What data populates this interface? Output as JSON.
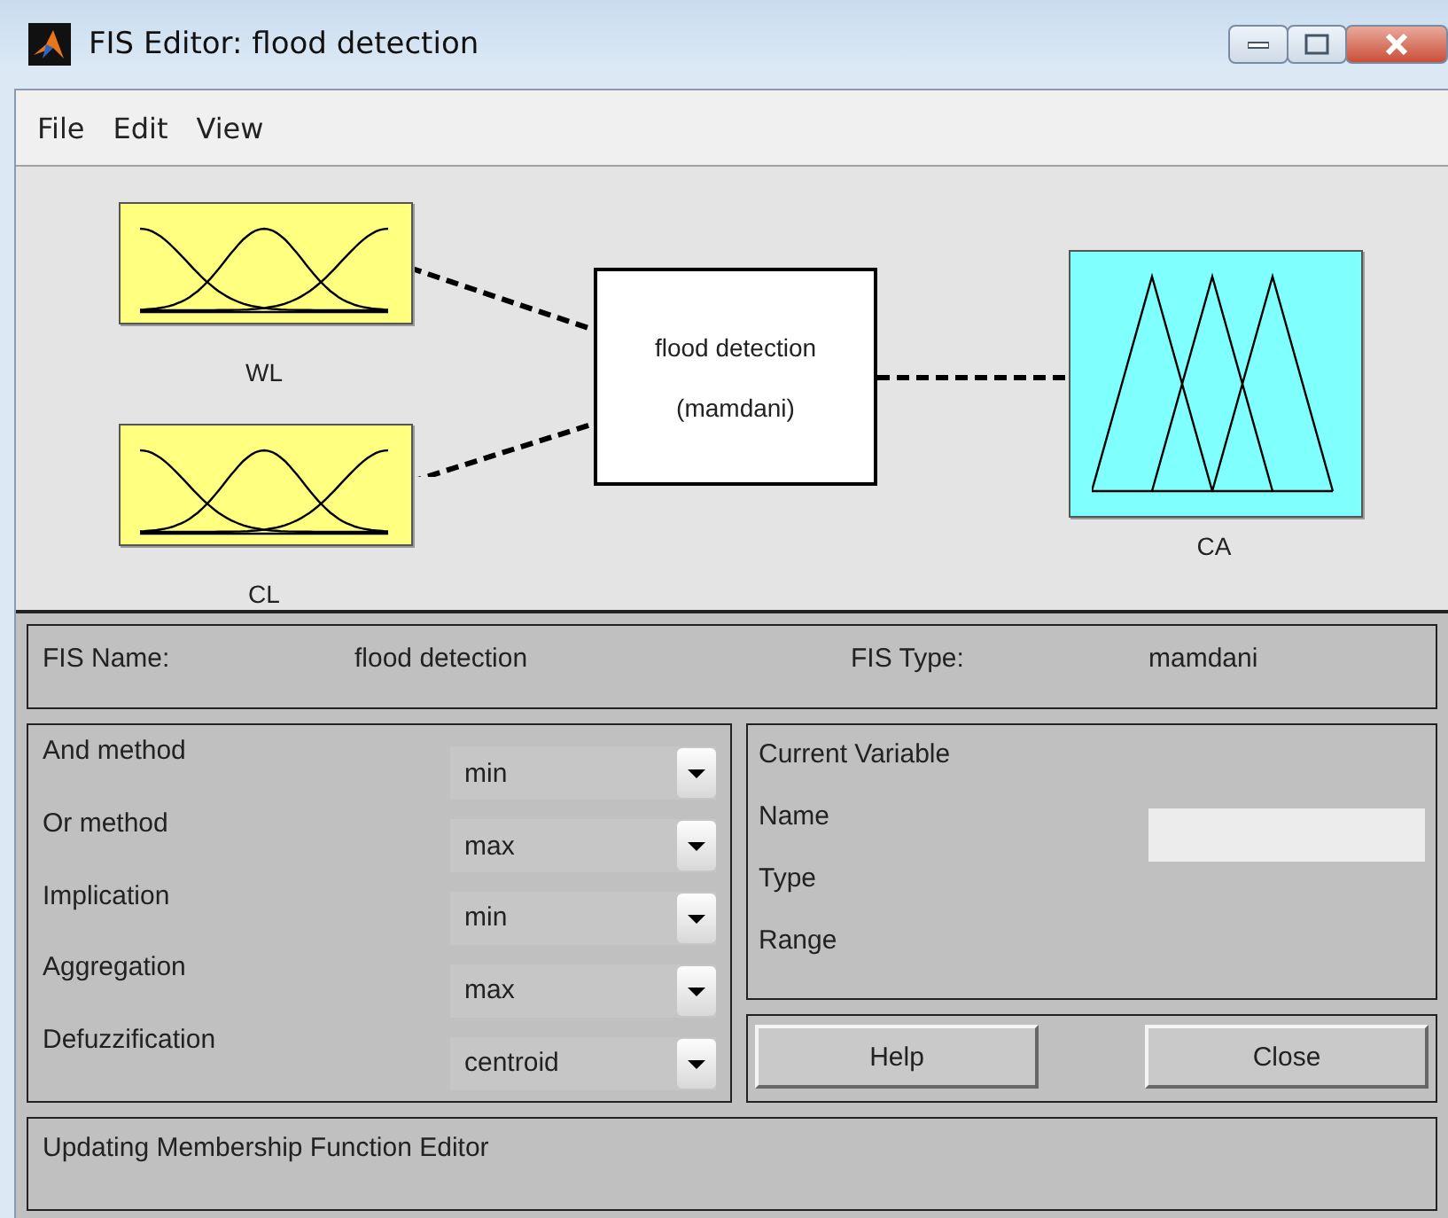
{
  "window": {
    "title": "FIS Editor: flood detection"
  },
  "menu": [
    "File",
    "Edit",
    "View"
  ],
  "diagram": {
    "inputs": [
      {
        "name": "WL"
      },
      {
        "name": "CL"
      }
    ],
    "system": {
      "name": "flood detection",
      "type": "(mamdani)"
    },
    "outputs": [
      {
        "name": "CA"
      }
    ]
  },
  "fis": {
    "name_label": "FIS Name:",
    "name": "flood detection",
    "type_label": "FIS Type:",
    "type": "mamdani"
  },
  "methods": [
    {
      "label": "And method",
      "value": "min"
    },
    {
      "label": "Or method",
      "value": "max"
    },
    {
      "label": "Implication",
      "value": "min"
    },
    {
      "label": "Aggregation",
      "value": "max"
    },
    {
      "label": "Defuzzification",
      "value": "centroid"
    }
  ],
  "current_variable": {
    "title": "Current Variable",
    "name_label": "Name",
    "type_label": "Type",
    "range_label": "Range"
  },
  "buttons": [
    "Help",
    "Close"
  ],
  "status": "Updating Membership Function Editor"
}
